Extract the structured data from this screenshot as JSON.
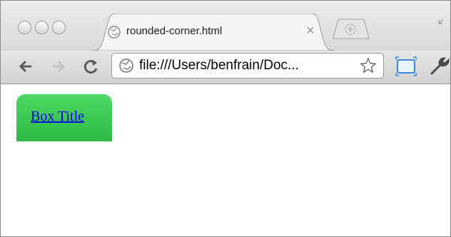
{
  "tab": {
    "title": "rounded-corner.html",
    "close_glyph": "×"
  },
  "toolbar": {
    "url": "file:///Users/benfrain/Doc..."
  },
  "page": {
    "box_title": "Box Title",
    "box_color": "#3ac852"
  },
  "icons": {
    "traffic_lights": [
      "close-light-icon",
      "minimize-light-icon",
      "zoom-light-icon"
    ],
    "nav": [
      "back-icon",
      "forward-icon",
      "reload-icon"
    ],
    "omnibox": [
      "globe-icon",
      "star-icon"
    ],
    "toolbar_right": [
      "page-icon",
      "wrench-icon"
    ]
  }
}
